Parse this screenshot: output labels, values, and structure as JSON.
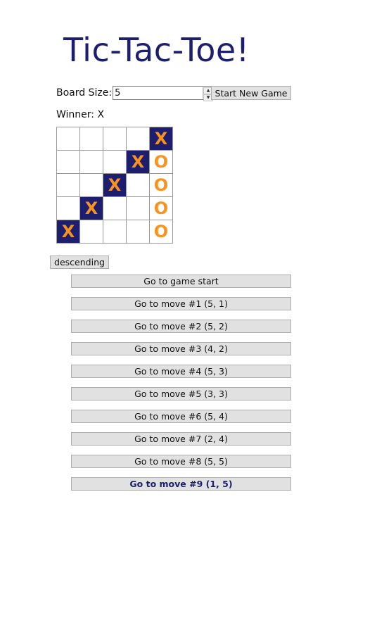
{
  "title": "Tic-Tac-Toe!",
  "controls": {
    "board_size_label": "Board Size:",
    "board_size_value": "5",
    "new_game_label": "Start New Game"
  },
  "status": "Winner: X",
  "board": {
    "cells": [
      "",
      "",
      "",
      "",
      "X",
      "",
      "",
      "",
      "X",
      "O",
      "",
      "",
      "X",
      "",
      "O",
      "",
      "X",
      "",
      "",
      "O",
      "X",
      "",
      "",
      "",
      "O"
    ],
    "winning_cells": [
      4,
      8,
      12,
      16,
      20
    ]
  },
  "sort_label": "descending",
  "moves": [
    "Go to game start",
    "Go to move #1 (5, 1)",
    "Go to move #2 (5, 2)",
    "Go to move #3 (4, 2)",
    "Go to move #4 (5, 3)",
    "Go to move #5 (3, 3)",
    "Go to move #6 (5, 4)",
    "Go to move #7 (2, 4)",
    "Go to move #8 (5, 5)",
    "Go to move #9 (1, 5)"
  ],
  "current_move": 9,
  "colors": {
    "title": "#1d1f6e",
    "winning_cell_bg": "#1e1e6e",
    "mark": "#f7931e"
  }
}
